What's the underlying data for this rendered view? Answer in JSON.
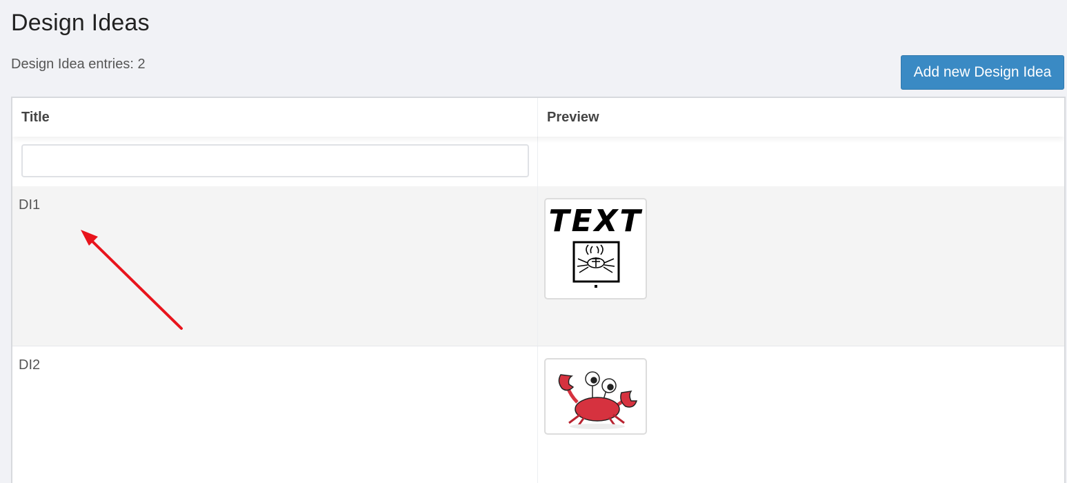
{
  "page": {
    "title": "Design Ideas",
    "entry_count": "Design Idea entries: 2",
    "add_button_label": "Add new Design Idea"
  },
  "table": {
    "columns": [
      "Title",
      "Preview"
    ],
    "filter": {
      "value": "",
      "placeholder": ""
    },
    "rows": [
      {
        "title": "DI1",
        "preview_text": "TEXT",
        "preview_icon": "crab-seal-icon"
      },
      {
        "title": "DI2",
        "preview_icon": "cartoon-crab-icon"
      }
    ]
  },
  "annotation": {
    "arrow_color": "#e8141c",
    "icon": "red-arrow-icon"
  },
  "colors": {
    "accent": "#3a8ac4",
    "background": "#f1f2f6",
    "crab_red": "#d6323f"
  }
}
